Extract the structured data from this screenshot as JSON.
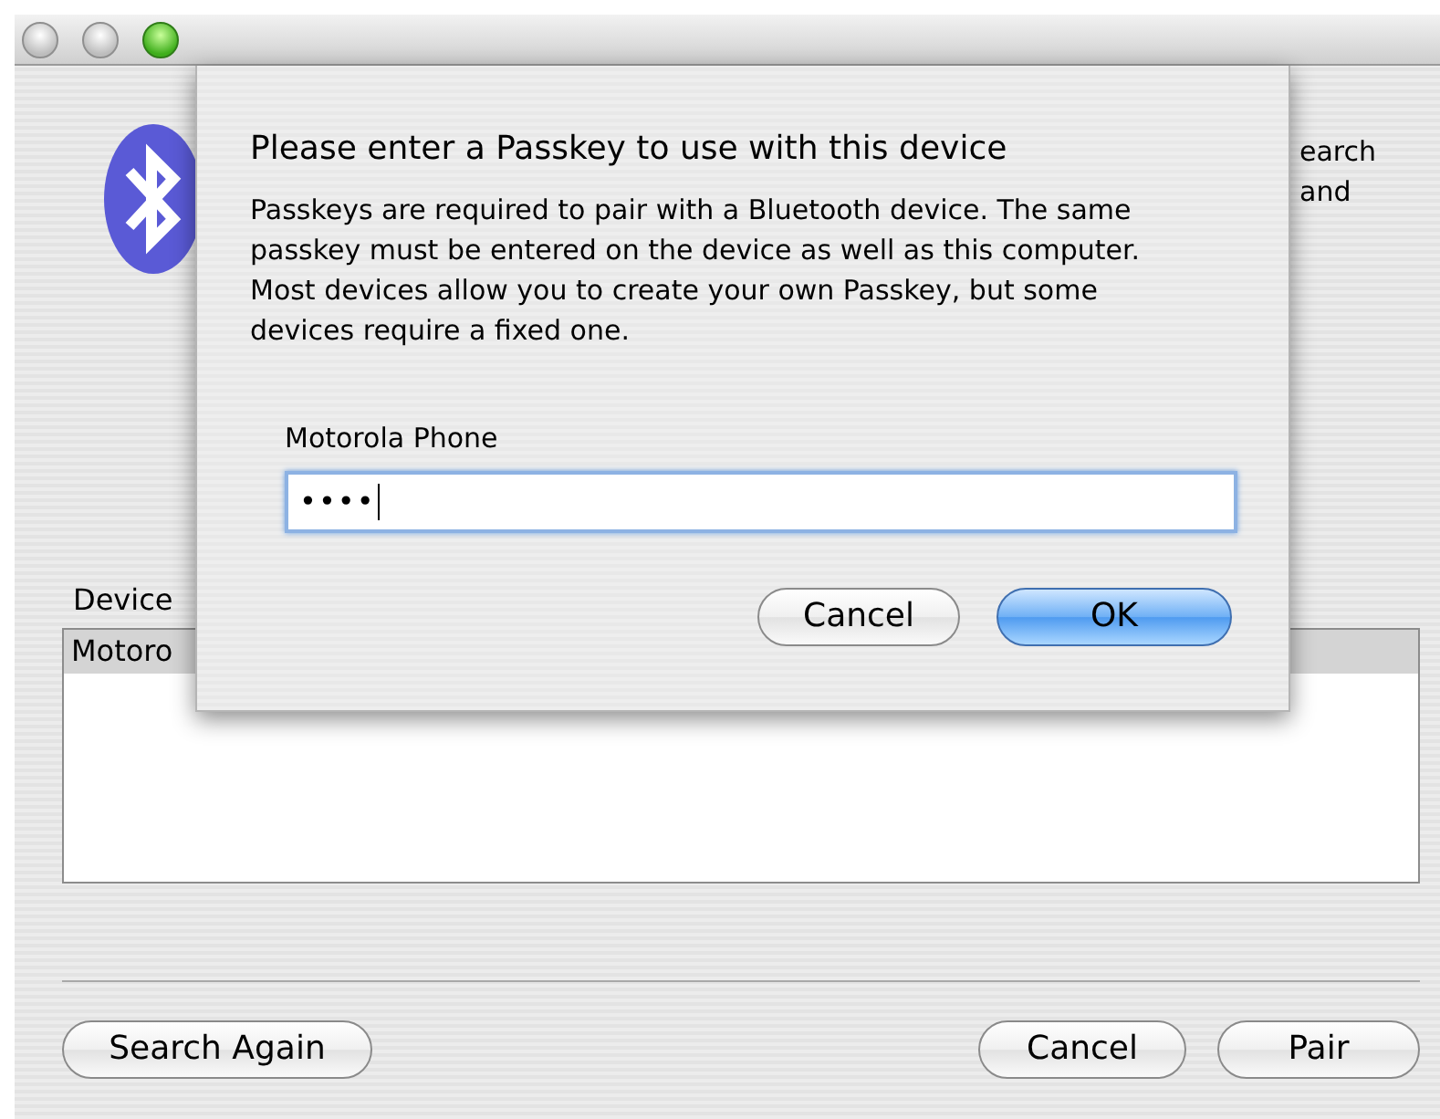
{
  "window": {
    "controls": [
      {
        "active": false
      },
      {
        "active": false
      },
      {
        "active": true
      }
    ]
  },
  "background": {
    "intro_lines": [
      "earch",
      "and"
    ],
    "list_label": "Device",
    "rows": [
      {
        "text": "Motoro",
        "selected": true
      }
    ],
    "buttons": [
      {
        "label": "Search Again"
      },
      {
        "label": "Cancel"
      },
      {
        "label": "Pair"
      }
    ]
  },
  "sheet": {
    "title": "Please enter a Passkey to use with this device",
    "message": "Passkeys are required to pair with a Bluetooth device.  The same passkey must be entered on the device as well as this computer. Most devices allow you to create your own Passkey, but some devices require a fixed one.",
    "field": {
      "label": "Motorola Phone",
      "value": "••••",
      "focused": true
    },
    "buttons": [
      {
        "label": "Cancel",
        "default": false
      },
      {
        "label": "OK",
        "default": true
      }
    ]
  }
}
